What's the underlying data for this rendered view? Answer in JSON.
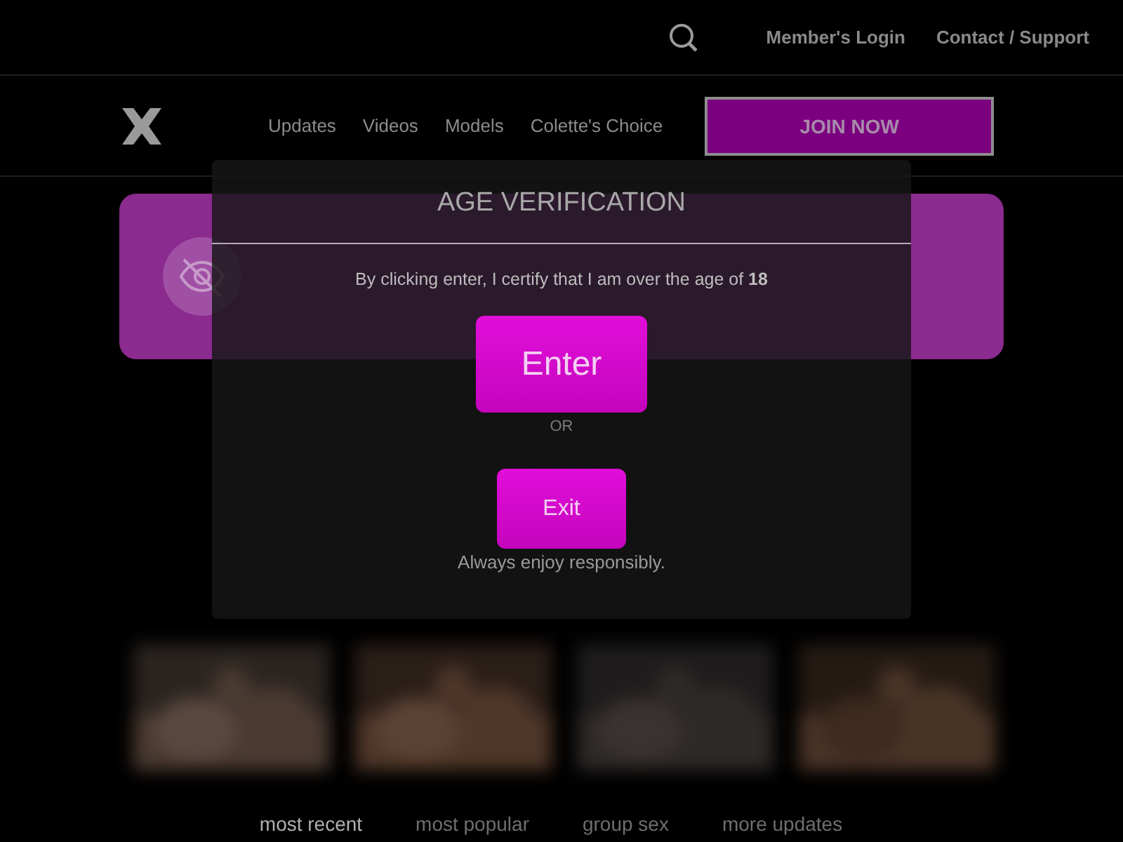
{
  "top_bar": {
    "links": [
      "Member's Login",
      "Contact / Support"
    ]
  },
  "nav": {
    "items": [
      "Updates",
      "Videos",
      "Models",
      "Colette's Choice"
    ],
    "join_button": "JOIN NOW"
  },
  "tabs": [
    {
      "label": "most recent",
      "selected": true
    },
    {
      "label": "most popular",
      "selected": false
    },
    {
      "label": "group sex",
      "selected": false
    },
    {
      "label": "more updates",
      "selected": false
    }
  ],
  "modal": {
    "title": "AGE VERIFICATION",
    "statement": "By clicking enter, I certify that I am over the age of **18**",
    "enter_button": "Enter",
    "separator": "OR",
    "exit_button": "Exit",
    "footer": "Always enjoy responsibly."
  }
}
